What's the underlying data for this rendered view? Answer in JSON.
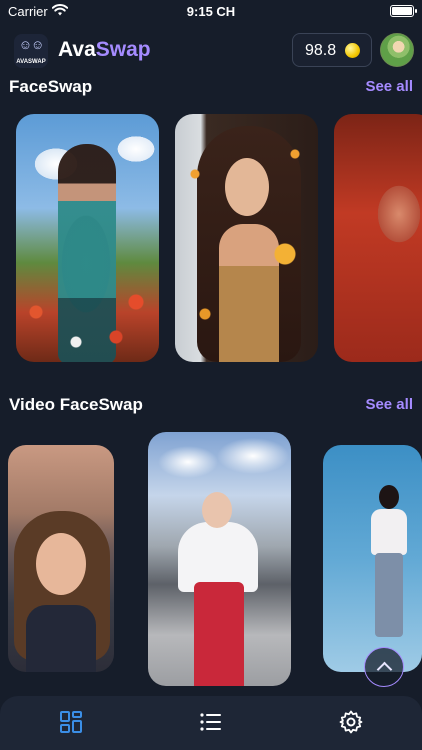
{
  "status_bar": {
    "carrier": "Carrier",
    "time": "9:15 CH"
  },
  "header": {
    "logo_text": "AVASWAP",
    "title_part1": "Ava",
    "title_part2": "Swap",
    "coins": "98.8"
  },
  "sections": [
    {
      "title": "FaceSwap",
      "see_all": "See all"
    },
    {
      "title": "Video FaceSwap",
      "see_all": "See all"
    }
  ],
  "colors": {
    "accent": "#a58bff",
    "background": "#161d2a",
    "tab_active": "#3b8ee6",
    "tab_inactive": "#ffffff"
  },
  "tabs": [
    {
      "icon": "grid-icon",
      "active": true
    },
    {
      "icon": "list-icon",
      "active": false
    },
    {
      "icon": "gear-icon",
      "active": false
    }
  ]
}
